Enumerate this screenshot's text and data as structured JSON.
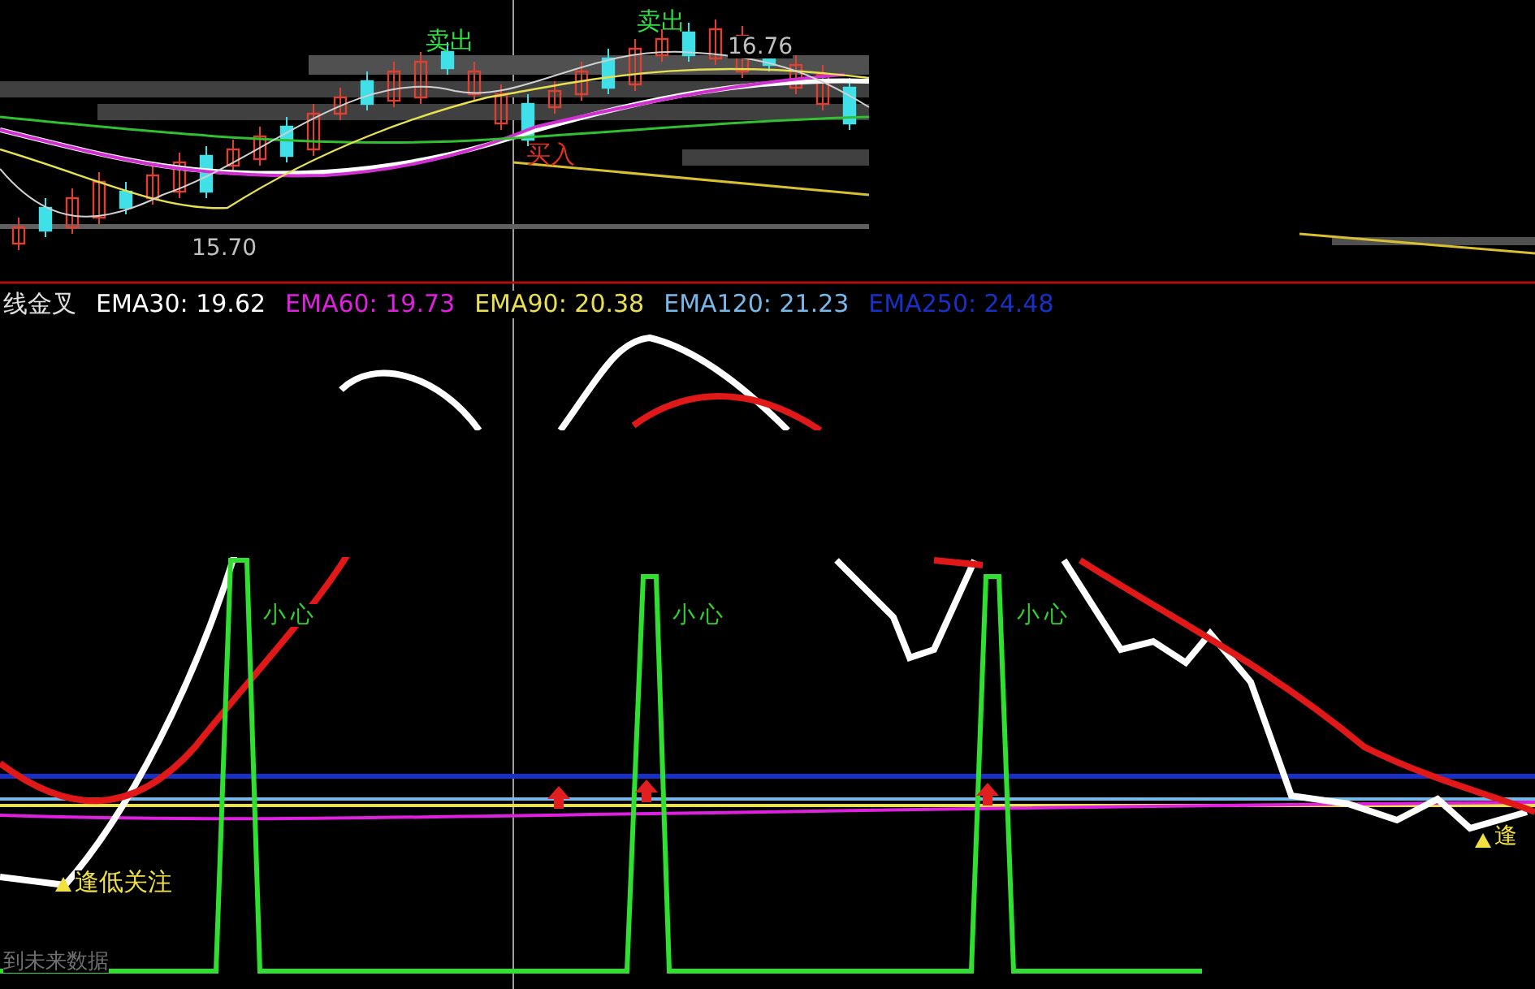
{
  "price_panel": {
    "signals": [
      {
        "text": "卖出",
        "kind": "sell"
      },
      {
        "text": "卖出",
        "kind": "sell"
      },
      {
        "text": "买入",
        "kind": "buy"
      }
    ],
    "high_label": "16.76",
    "low_label": "15.70"
  },
  "indicator_panel": {
    "title": "线金叉",
    "legend": [
      {
        "text": "EMA30: 19.62",
        "color": "#ffffff"
      },
      {
        "text": "EMA60: 19.73",
        "color": "#e020e0"
      },
      {
        "text": "EMA90: 20.38",
        "color": "#e8e050"
      },
      {
        "text": "EMA120: 21.23",
        "color": "#78b8e8"
      },
      {
        "text": "EMA250: 24.48",
        "color": "#1830c8"
      }
    ],
    "warnings": [
      "小心",
      "小心",
      "小心"
    ],
    "low_signal": "逢低关注",
    "edge_signal": "逢",
    "footer": "到未来数据"
  }
}
